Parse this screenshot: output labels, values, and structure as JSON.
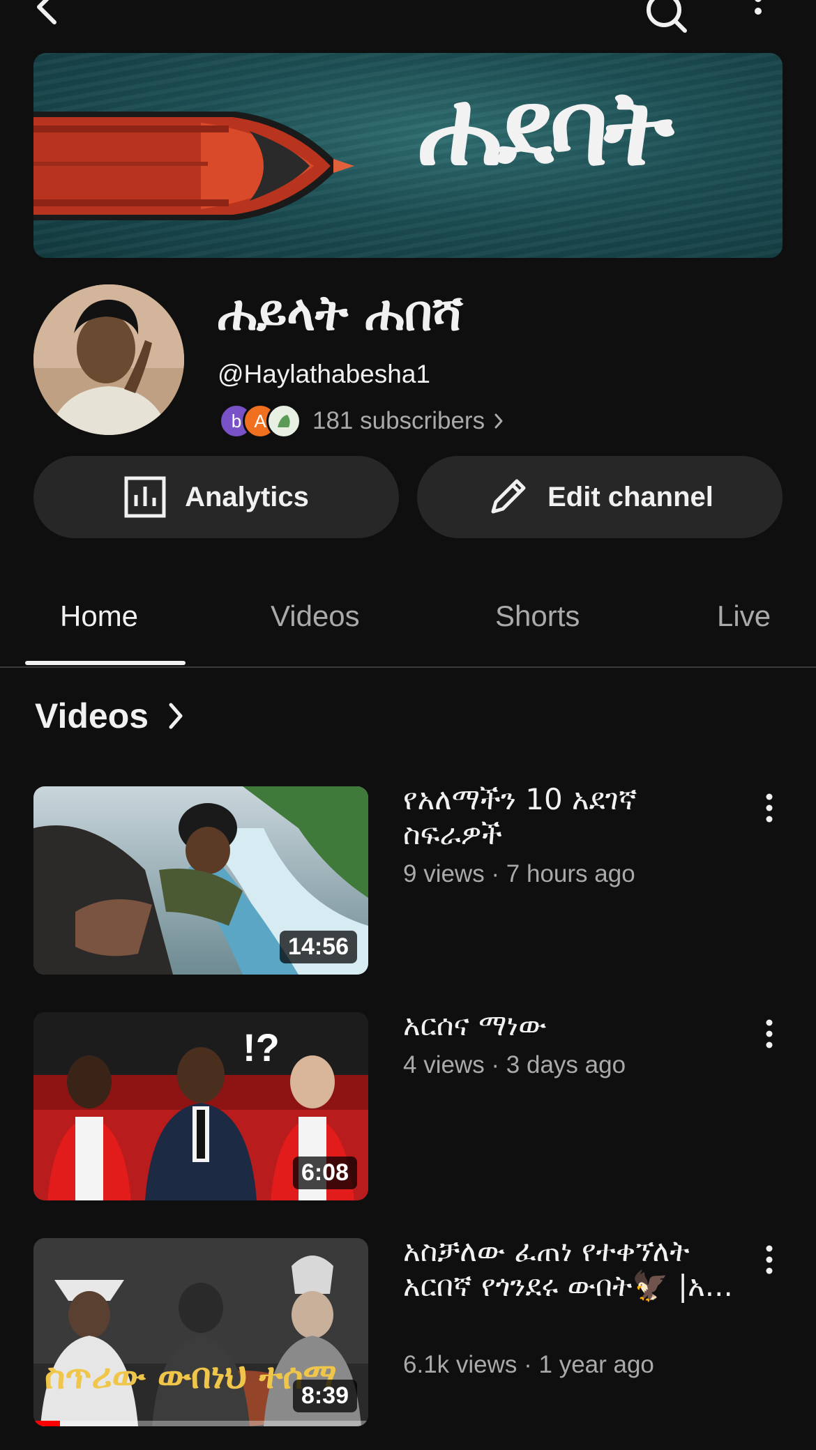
{
  "topbar": {
    "back_icon": "back-arrow-icon",
    "search_icon": "search-icon",
    "more_icon": "more-vert-icon"
  },
  "banner": {
    "title": "ሐደባት"
  },
  "channel": {
    "name": "ሐይላት ሐበሻ",
    "handle": "@Haylathabesha1",
    "subscriber_avatars": [
      "b",
      "A",
      ""
    ],
    "subscribers": "181 subscribers"
  },
  "actions": {
    "analytics_label": "Analytics",
    "edit_label": "Edit channel"
  },
  "tabs": [
    {
      "label": "Home",
      "active": true
    },
    {
      "label": "Videos",
      "active": false
    },
    {
      "label": "Shorts",
      "active": false
    },
    {
      "label": "Live",
      "active": false
    }
  ],
  "section": {
    "title": "Videos"
  },
  "videos": [
    {
      "title": "የአለማችን 10 አደገኛ ስፍራዎች",
      "meta": "9 views · 7 hours ago",
      "duration": "14:56",
      "watched_fraction": 0
    },
    {
      "title": "አርሰና ማነው",
      "meta": "4 views · 3 days ago",
      "duration": "6:08",
      "watched_fraction": 0
    },
    {
      "title": "አስቻለው ፈጠነ የተቀኘለት አርበኛ የጎንደሩ ውበት🦅 |አ...",
      "meta": "6.1k views · 1 year ago",
      "duration": "8:39",
      "thumb_text": "ስጥሪው ውበነህ ተሰማ",
      "watched_fraction": 0.08
    }
  ],
  "colors": {
    "background": "#0f0f0f",
    "pill": "#272727",
    "text_secondary": "#aaaaaa",
    "progress": "#ff0000"
  }
}
